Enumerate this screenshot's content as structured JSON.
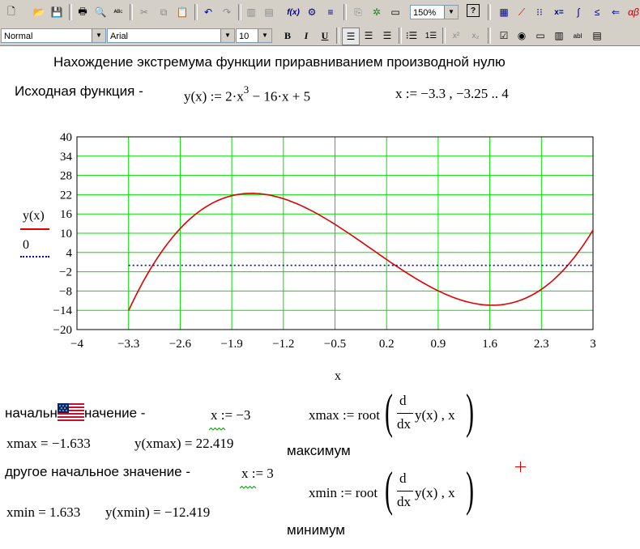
{
  "toolbar": {
    "style_value": "Normal",
    "font_value": "Arial",
    "size_value": "10",
    "zoom_value": "150%",
    "bold": "B",
    "italic": "I",
    "underline": "U",
    "fx": "f(x)",
    "xeq": "x="
  },
  "doc": {
    "title": "Нахождение экстремума функции приравниванием производной нулю",
    "source_label": "Исходная функция -",
    "func_def": "y(x) := 2·x",
    "func_exp": "3",
    "func_rest": "− 16·x + 5",
    "range_def": "x := −3.3 , −3.25 .. 4",
    "initial_label_left": "начальн",
    "initial_label_right": "начение -",
    "x_init1": "x := −3",
    "xmax_def": "xmax := root",
    "d_num": "d",
    "d_den": "dx",
    "root_args": "y(x) , x",
    "xmax_val": "xmax = −1.633",
    "yxmax_val": "y(xmax) = 22.419",
    "max_label": "максимум",
    "other_label": "другое начальное значение -",
    "x_init2": "x := 3",
    "xmin_def": "xmin := root",
    "xmin_val": "xmin = 1.633",
    "yxmin_val": "y(xmin) = −12.419",
    "min_label": "минимум"
  },
  "chart_data": {
    "type": "line",
    "xlabel": "x",
    "ylabel": "y(x)",
    "xlim": [
      -4,
      3
    ],
    "ylim": [
      -20,
      40
    ],
    "x_ticks": [
      -4,
      -3.3,
      -2.6,
      -1.9,
      -1.2,
      -0.5,
      0.2,
      0.9,
      1.6,
      2.3,
      3
    ],
    "x_tick_labels": [
      "−4",
      "−3.3",
      "−2.6",
      "−1.9",
      "−1.2",
      "−0.5",
      "0.2",
      "0.9",
      "1.6",
      "2.3",
      "3"
    ],
    "y_ticks": [
      -20,
      -14,
      -8,
      -2,
      4,
      10,
      16,
      22,
      28,
      34,
      40
    ],
    "y_tick_labels": [
      "−20",
      "−14",
      "−8",
      "−2",
      "4",
      "10",
      "16",
      "22",
      "28",
      "34",
      "40"
    ],
    "grid": true,
    "series": [
      {
        "name": "y(x)",
        "color": "#e00000",
        "style": "solid",
        "x_start": -3.3,
        "x_end": 3,
        "x_step": 0.05
      },
      {
        "name": "0",
        "color": "#0000c8",
        "style": "dotted",
        "x_start": -3.3,
        "x_end": 3,
        "value": 0
      }
    ],
    "grid_color": "#00e000"
  }
}
